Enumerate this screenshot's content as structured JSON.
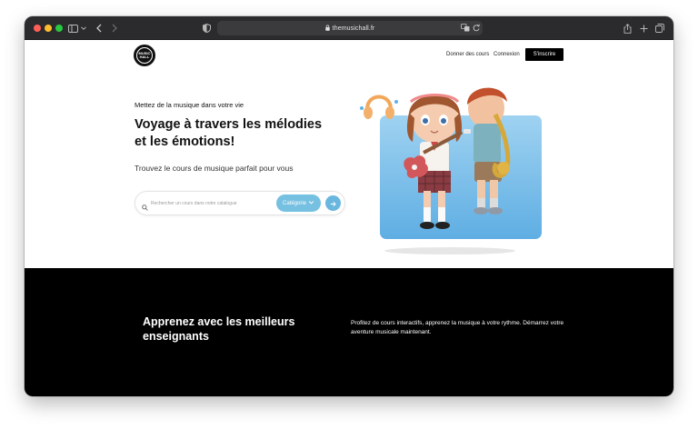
{
  "browser": {
    "url": "themusichall.fr"
  },
  "nav": {
    "logo_text_top": "MUSIC",
    "logo_text_bottom": "HALL",
    "link_teach": "Donner des cours",
    "link_login": "Connexion",
    "signup": "S'inscrire"
  },
  "hero": {
    "eyebrow": "Mettez de la musique dans votre vie",
    "headline": "Voyage à travers les mélodies et les émotions!",
    "subtitle": "Trouvez le cours de musique parfait pour vous",
    "search_placeholder": "Rechercher un cours dans notre catalogue",
    "category_label": "Catégorie"
  },
  "section": {
    "title": "Apprenez avec les meilleurs enseignants",
    "text": "Profitez de cours interactifs, apprenez la musique à votre rythme. Démarrez votre aventure musicale maintenant."
  },
  "colors": {
    "accent": "#76c0e2",
    "dark_section": "#000000",
    "toolbar": "#2b2b2d"
  },
  "icons": [
    "sidebar-icon",
    "back-icon",
    "forward-icon",
    "shield-icon",
    "lock-icon",
    "translate-icon",
    "reload-icon",
    "share-icon",
    "new-tab-icon",
    "tabs-icon",
    "search-icon",
    "chevron-down-icon",
    "arrow-right-icon"
  ]
}
